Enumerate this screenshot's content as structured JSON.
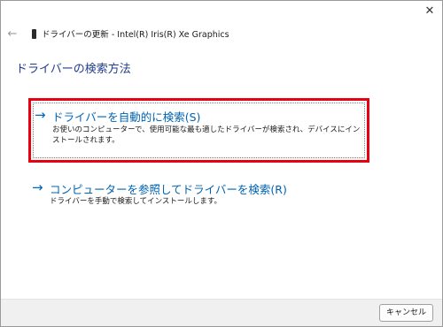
{
  "window": {
    "title": "ドライバーの更新 - Intel(R) Iris(R) Xe Graphics",
    "close_glyph": "✕",
    "back_glyph": "←",
    "device_icon": "display-adapter-icon"
  },
  "main": {
    "heading": "ドライバーの検索方法",
    "options": [
      {
        "arrow": "→",
        "label": "ドライバーを自動的に検索(S)",
        "description": "お使いのコンピューターで、使用可能な最も適したドライバーが検索され、デバイスにインストールされます。",
        "highlighted": true,
        "highlight_color": "#e60012"
      },
      {
        "arrow": "→",
        "label": "コンピューターを参照してドライバーを検索(R)",
        "description": "ドライバーを手動で検索してインストールします。"
      }
    ]
  },
  "footer": {
    "cancel_label": "キャンセル"
  },
  "colors": {
    "link": "#0063b1",
    "heading": "#1f3d8c",
    "footer_bg": "#f0f0f0"
  }
}
